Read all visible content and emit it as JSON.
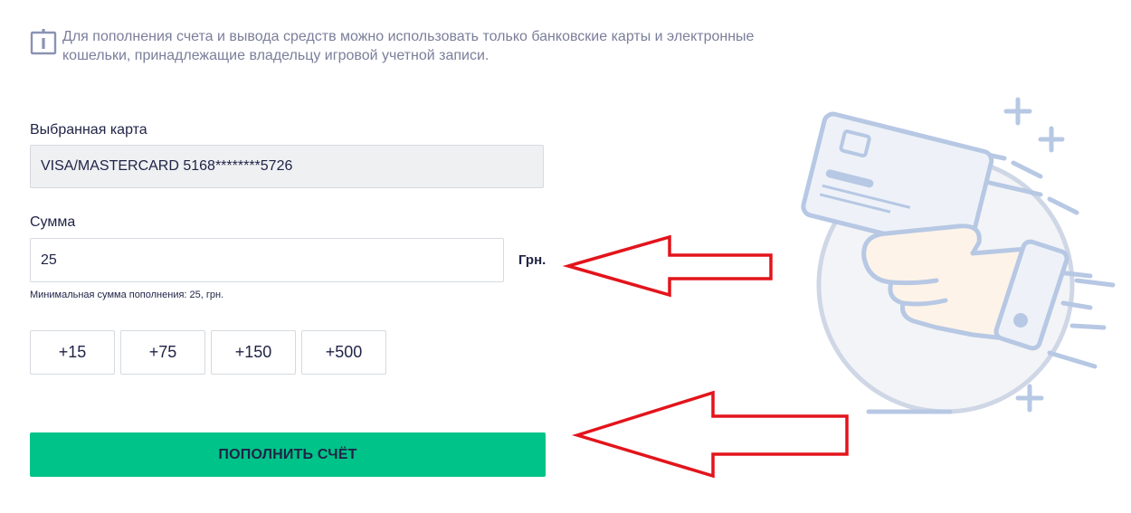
{
  "notice": {
    "icon": "info-icon",
    "text_line1": "Для пополнения счета и вывода средств можно использовать только банковские карты и электронные",
    "text_line2": "кошельки, принадлежащие владельцу игровой учетной записи."
  },
  "card": {
    "label": "Выбранная карта",
    "value": "VISA/MASTERCARD 5168********5726"
  },
  "amount": {
    "label": "Сумма",
    "value": "25",
    "currency": "Грн.",
    "hint": "Минимальная сумма пополнения: 25, грн."
  },
  "quick_amounts": [
    "+15",
    "+75",
    "+150",
    "+500"
  ],
  "submit": {
    "label": "ПОПОЛНИТЬ СЧЁТ"
  },
  "colors": {
    "accent": "#00c389",
    "text": "#1f2346",
    "muted": "#7a7f9a",
    "annotation_arrow": "#e3141b",
    "illustration": "#b7c8e4"
  },
  "illustration": "hand-holding-card-illustration",
  "annotations": [
    "red-arrow-icon",
    "red-arrow-icon"
  ]
}
